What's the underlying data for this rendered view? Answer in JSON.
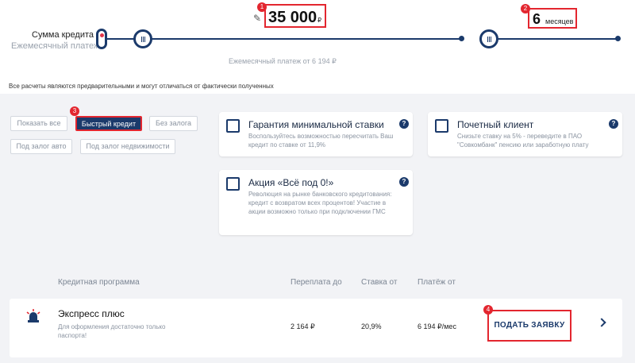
{
  "sliders": {
    "sum_label": "Сумма кредита",
    "monthly_label": "Ежемесячный платеж",
    "amount_value": "35 000",
    "amount_currency": "₽",
    "term_value": "6",
    "term_unit": "месяцев",
    "payment_note": "Ежемесячный платеж от 6 194 ₽"
  },
  "disclaimer": "Все расчеты являются предварительными и могут отличаться от фактически полученных",
  "annotations": [
    "1",
    "2",
    "3",
    "4"
  ],
  "filters": {
    "show_all": "Показать все",
    "quick_credit": "Быстрый кредит",
    "no_collateral": "Без залога",
    "auto_collateral": "Под залог авто",
    "realty_collateral": "Под залог недвижимости"
  },
  "options": [
    {
      "title": "Гарантия минимальной ставки",
      "desc": "Воспользуйтесь возможностью пересчитать Ваш кредит по ставке от 11,9%",
      "help": "?"
    },
    {
      "title": "Почетный клиент",
      "desc": "Снизьте ставку на 5% - переведите в ПАО \"Совкомбанк\" пенсию или заработную плату",
      "help": "?"
    },
    {
      "title": "Акция «Всё под 0!»",
      "desc": "Революция на рынке банковского кредитования: кредит с возвратом всех процентов! Участие в акции возможно только при подключении ГМС",
      "help": "?"
    }
  ],
  "table": {
    "headers": {
      "program": "Кредитная программа",
      "overpay": "Переплата до",
      "rate": "Ставка от",
      "payment": "Платёж от"
    },
    "row": {
      "name": "Экспресс плюс",
      "desc": "Для оформления достаточно только паспорта!",
      "overpay": "2 164 ₽",
      "rate": "20,9%",
      "payment": "6 194 ₽/мес",
      "apply": "ПОДАТЬ ЗАЯВКУ"
    }
  },
  "colors": {
    "brand_navy": "#1b3a6b",
    "highlight_red": "#e3262f",
    "page_bg": "#f2f3f6"
  }
}
